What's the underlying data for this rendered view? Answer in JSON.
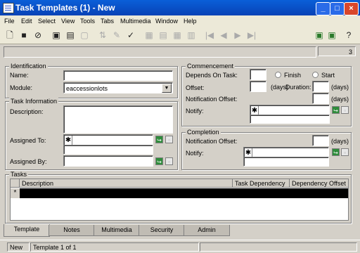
{
  "window": {
    "title": "Task Templates (1) - New",
    "min": "_",
    "max": "□",
    "close": "×"
  },
  "menu": [
    "File",
    "Edit",
    "Select",
    "View",
    "Tools",
    "Tabs",
    "Multimedia",
    "Window",
    "Help"
  ],
  "toolbar": {
    "nav_first": "|◀",
    "nav_prev": "◀",
    "nav_next": "▶",
    "nav_last": "▶|"
  },
  "record_count": "3",
  "identification": {
    "title": "Identification",
    "name_label": "Name:",
    "name_value": "",
    "module_label": "Module:",
    "module_value": "eaccessionlots"
  },
  "task_info": {
    "title": "Task Information",
    "description_label": "Description:",
    "assigned_to_label": "Assigned To:",
    "assigned_by_label": "Assigned By:"
  },
  "commencement": {
    "title": "Commencement",
    "depends_label": "Depends On Task:",
    "finish_label": "Finish",
    "start_label": "Start",
    "offset_label": "Offset:",
    "days1": "(days)",
    "duration_label": "Duration:",
    "days2": "(days)",
    "notif_offset_label": "Notification Offset:",
    "days3": "(days)",
    "notify_label": "Notify:"
  },
  "completion": {
    "title": "Completion",
    "notif_offset_label": "Notification Offset:",
    "days": "(days)",
    "notify_label": "Notify:"
  },
  "tasks": {
    "title": "Tasks",
    "columns": [
      "Description",
      "Task Dependency",
      "Dependency Offset"
    ],
    "new_row_marker": "*"
  },
  "tabs": [
    "Template",
    "Notes",
    "Multimedia",
    "Security",
    "Admin"
  ],
  "status": {
    "mode": "New",
    "position": "Template 1 of 1"
  }
}
